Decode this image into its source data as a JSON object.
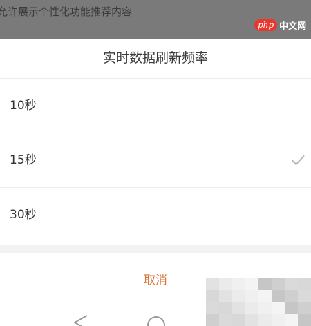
{
  "background": {
    "text": "允许展示个性化功能推荐内容"
  },
  "watermark": {
    "php": "php",
    "cn": "中文网"
  },
  "dialog": {
    "title": "实时数据刷新频率",
    "options": [
      {
        "label": "10秒",
        "selected": false
      },
      {
        "label": "15秒",
        "selected": true
      },
      {
        "label": "30秒",
        "selected": false
      }
    ],
    "cancel_label": "取消"
  },
  "colors": {
    "accent": "#d9773a",
    "check": "#b5b5b5",
    "backdrop": "#7a7a7a"
  },
  "icons": {
    "selected": "check-icon",
    "nav_back": "back-triangle-icon",
    "nav_home": "home-circle-icon"
  }
}
